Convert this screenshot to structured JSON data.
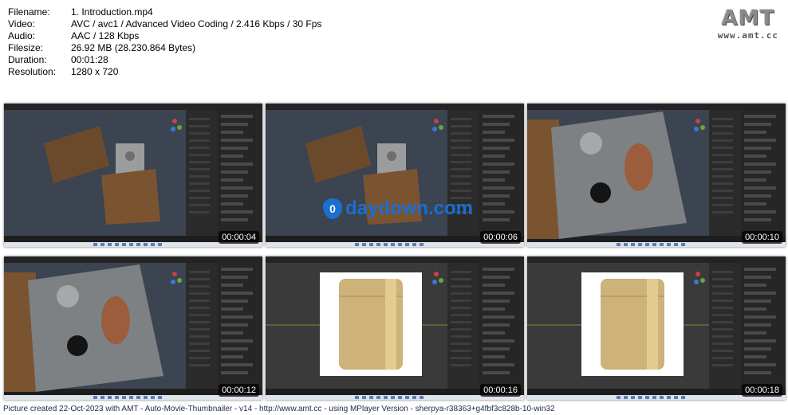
{
  "media_info": [
    {
      "key": "Filename:",
      "value": "1. Introduction.mp4"
    },
    {
      "key": "Video:",
      "value": "AVC / avc1 / Advanced Video Coding / 2.416 Kbps / 30 Fps"
    },
    {
      "key": "Audio:",
      "value": "AAC / 128 Kbps"
    },
    {
      "key": "Filesize:",
      "value": "26.92 MB (28.230.864 Bytes)"
    },
    {
      "key": "Duration:",
      "value": "00:01:28"
    },
    {
      "key": "Resolution:",
      "value": "1280 x 720"
    }
  ],
  "logo": {
    "mark": "AMT",
    "url": "www.amt.cc"
  },
  "thumbnails": [
    {
      "timestamp": "00:00:04",
      "scene": "lighter-closed"
    },
    {
      "timestamp": "00:00:06",
      "scene": "lighter-closed"
    },
    {
      "timestamp": "00:00:10",
      "scene": "wheel-closeup"
    },
    {
      "timestamp": "00:00:12",
      "scene": "wheel-closeup"
    },
    {
      "timestamp": "00:00:16",
      "scene": "reference-image"
    },
    {
      "timestamp": "00:00:18",
      "scene": "reference-image"
    }
  ],
  "watermark": {
    "text": "daydown.com",
    "drop_glyph": "0"
  },
  "footer": "Picture created 22-Oct-2023 with AMT - Auto-Movie-Thumbnailer - v14 - http://www.amt.cc - using MPlayer Version - sherpya-r38363+g4fbf3c828b-10-win32",
  "colors": {
    "accent": "#1a6fd1",
    "viewport": "#2f3237",
    "panel": "#2a2a2a"
  }
}
